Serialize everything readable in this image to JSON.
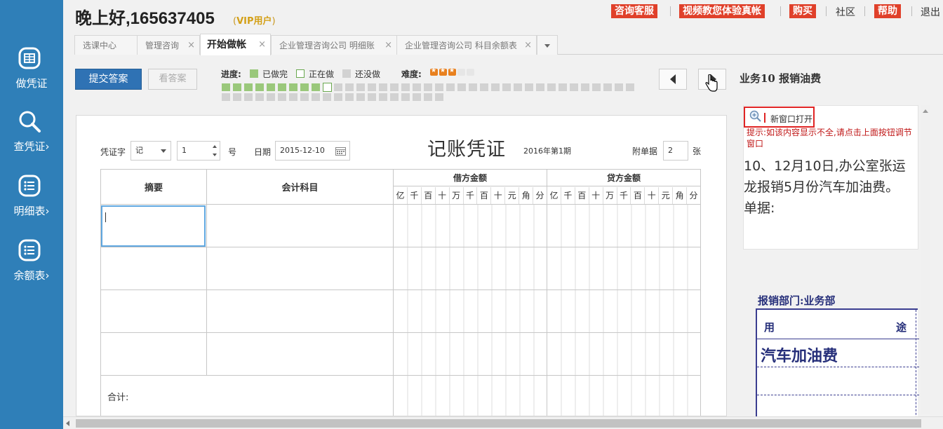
{
  "sidebar": {
    "items": [
      {
        "label": "做凭证",
        "icon": "voucher-icon"
      },
      {
        "label": "查凭证›",
        "icon": "search-icon"
      },
      {
        "label": "明细表›",
        "icon": "list-icon"
      },
      {
        "label": "余额表›",
        "icon": "list-icon"
      }
    ]
  },
  "header": {
    "greeting": "晚上好,165637405",
    "vip_open": "(",
    "vip_label": "VIP用户",
    "vip_close": ")",
    "links": {
      "consult": "咨询客服",
      "video": "视频教您体验真帐",
      "buy": "购买",
      "community": "社区",
      "help": "帮助",
      "logout": "退出"
    }
  },
  "tabs": [
    {
      "label": "选课中心",
      "closable": false
    },
    {
      "label": "管理咨询",
      "closable": true
    },
    {
      "label": "开始做帐",
      "closable": true,
      "active": true
    },
    {
      "label": "企业管理咨询公司 明细账",
      "closable": true
    },
    {
      "label": "企业管理咨询公司 科目余额表",
      "closable": true
    }
  ],
  "toolbar": {
    "submit": "提交答案",
    "view_answer": "看答案",
    "progress_label": "进度:",
    "legend_done": "已做完",
    "legend_current": "正在做",
    "legend_todo": "还没做",
    "difficulty_label": "难度:",
    "difficulty_stars": 3,
    "difficulty_max": 5,
    "progress_done": 9,
    "progress_current_index": 10,
    "progress_total": 57
  },
  "task": {
    "title": "业务10  报销油费"
  },
  "voucher": {
    "title": "记账凭证",
    "period": "2016年第1期",
    "word_label": "凭证字",
    "word_value": "记",
    "number_value": "1",
    "number_label": "号",
    "date_label": "日期",
    "date_value": "2015-12-10",
    "attach_label": "附单据",
    "attach_value": "2",
    "attach_unit": "张",
    "col_summary": "摘要",
    "col_account": "会计科目",
    "col_debit": "借方金额",
    "col_credit": "贷方金额",
    "digits": [
      "亿",
      "千",
      "百",
      "十",
      "万",
      "千",
      "百",
      "十",
      "元",
      "角",
      "分"
    ],
    "total_label": "合计:"
  },
  "question": {
    "open_window": "新窗口打开",
    "hint": "提示:如该内容显示不全,请点击上面按钮调节窗口",
    "text": "10、12月10日,办公室张运龙报销5月份汽车加油费。",
    "docs_label": "单据:"
  },
  "receipt": {
    "dept": "报销部门:业务部",
    "col_use_1": "用",
    "col_use_2": "途",
    "item": "汽车加油费"
  },
  "colors": {
    "sidebar": "#2f7fb8",
    "accent_red": "#e0402a",
    "progress_done": "#9ac87b",
    "submit_blue": "#2f72b4"
  }
}
